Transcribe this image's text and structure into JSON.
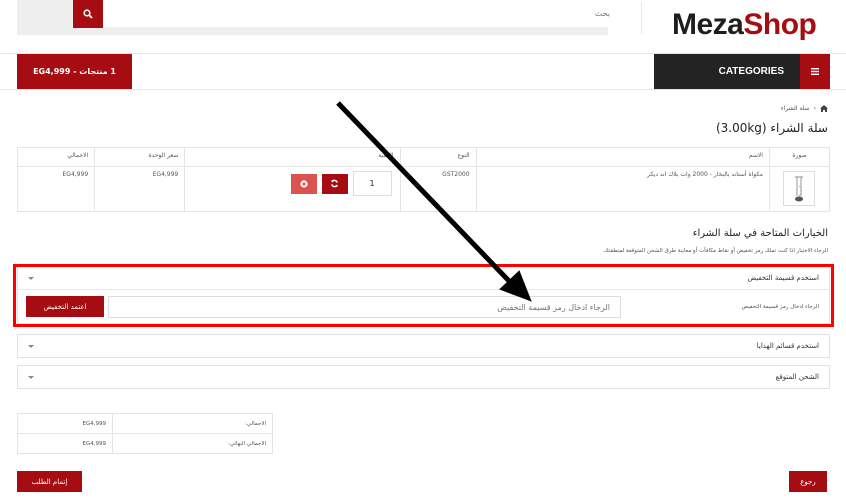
{
  "header": {
    "logo_part1": "Meza",
    "logo_part2": "Shop",
    "search": {
      "placeholder": "بحث",
      "icon": "search-icon"
    }
  },
  "nav": {
    "cart_summary": "1 منتجات - EG4,999",
    "categories_label": "CATEGORIES",
    "menu_icon": "hamburger-icon"
  },
  "breadcrumb": {
    "home_icon": "home-icon",
    "separator": "›",
    "current": "سلة الشراء"
  },
  "page": {
    "title": "سلة الشراء  (3.00kg)"
  },
  "cart_table": {
    "headers": {
      "image": "صورة",
      "name": "الاسم",
      "model": "النوع",
      "quantity": "الكمية",
      "unit_price": "سعر الوحدة",
      "total": "الاجمالي"
    },
    "rows": [
      {
        "name": "مكواة أستاند بالبخار - 2000 وات بلاك اند ديكر",
        "model": "GST2000",
        "quantity": "1",
        "unit_price": "EG4,999",
        "total": "EG4,999"
      }
    ]
  },
  "options": {
    "title": "الخيارات المتاحة في سلة الشراء",
    "description": "الرجاء الاختيار اذا كنت تملك رمز تخفيض أو نقاط مكافآت أو معاينة طرق الشحن المتوقعة لمنطقتك.",
    "panels": [
      {
        "title": "استخدم قسيمة التخفيض",
        "expanded": true,
        "field_label": "الرجاء ادخال رمز قسيمة التخفيض",
        "input_placeholder": "الرجاء ادخال رمز قسيمة التخفيض",
        "button_label": "اعتمد التخفيض"
      },
      {
        "title": "استخدم قسائم الهدايا",
        "expanded": false
      },
      {
        "title": "الشحن المتوقع",
        "expanded": false
      }
    ]
  },
  "totals": [
    {
      "label": "الاجمالي:",
      "value": "EG4,999"
    },
    {
      "label": "الاجمالي النهائي:",
      "value": "EG4,999"
    }
  ],
  "actions": {
    "checkout_label": "إتمام الطلب",
    "back_label": "رجوع"
  },
  "colors": {
    "brand": "#a50d12",
    "dark_nav": "#232323",
    "remove": "#d9534f",
    "highlight": "#ff0000"
  }
}
